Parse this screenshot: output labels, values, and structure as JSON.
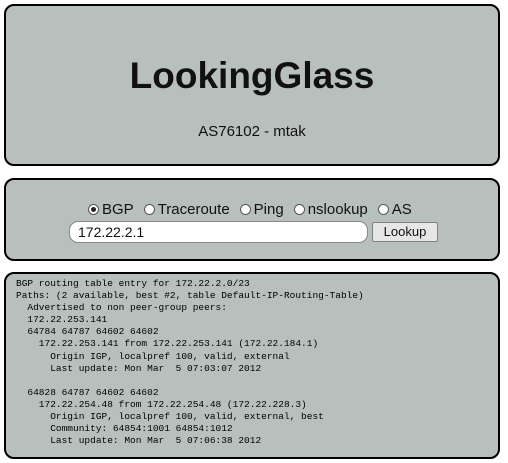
{
  "header": {
    "title": "LookingGlass",
    "subtitle": "AS76102 - mtak"
  },
  "query": {
    "options": [
      {
        "label": "BGP",
        "selected": true
      },
      {
        "label": "Traceroute",
        "selected": false
      },
      {
        "label": "Ping",
        "selected": false
      },
      {
        "label": "nslookup",
        "selected": false
      },
      {
        "label": "AS",
        "selected": false
      }
    ],
    "host_value": "172.22.2.1",
    "submit_label": "Lookup"
  },
  "result": {
    "lines": [
      "BGP routing table entry for 172.22.2.0/23",
      "Paths: (2 available, best #2, table Default-IP-Routing-Table)",
      "  Advertised to non peer-group peers:",
      "  172.22.253.141",
      "  64784 64787 64602 64602",
      "    172.22.253.141 from 172.22.253.141 (172.22.184.1)",
      "      Origin IGP, localpref 100, valid, external",
      "      Last update: Mon Mar  5 07:03:07 2012",
      "",
      "  64828 64787 64602 64602",
      "    172.22.254.48 from 172.22.254.48 (172.22.228.3)",
      "      Origin IGP, localpref 100, valid, external, best",
      "      Community: 64854:1001 64854:1012",
      "      Last update: Mon Mar  5 07:06:38 2012"
    ]
  }
}
